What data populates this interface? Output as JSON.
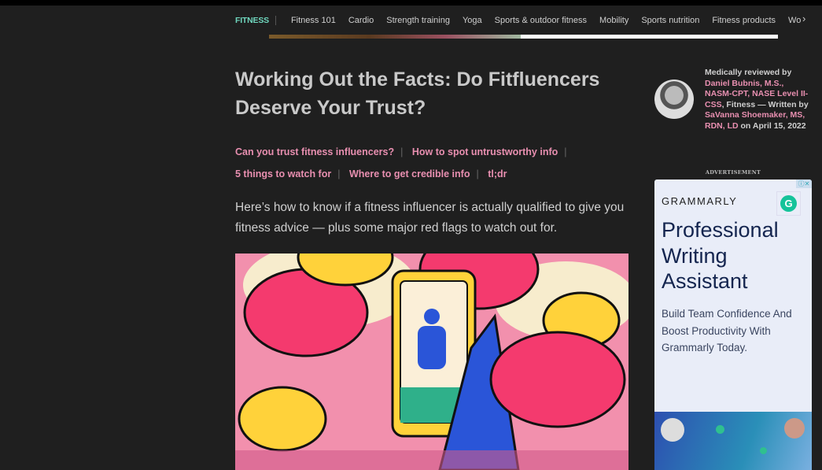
{
  "nav": {
    "brand": "FITNESS",
    "items": [
      "Fitness 101",
      "Cardio",
      "Strength training",
      "Yoga",
      "Sports & outdoor fitness",
      "Mobility",
      "Sports nutrition",
      "Fitness products",
      "Wo"
    ]
  },
  "article": {
    "title": "Working Out the Facts: Do Fitfluencers Deserve Your Trust?",
    "toc": [
      "Can you trust fitness influencers?",
      "How to spot untrustworthy info",
      "5 things to watch for",
      "Where to get credible info",
      "tl;dr"
    ],
    "intro": "Here’s how to know if a fitness influencer is actually qualified to give you fitness advice — plus some major red flags to watch out for."
  },
  "byline": {
    "prefix": "Medically reviewed by",
    "reviewer": "Daniel Bubnis, M.S., NASM-CPT, NASE Level II-CSS",
    "mid": ", Fitness — Written by",
    "author": "SaVanna Shoemaker, MS, RDN, LD",
    "date_prefix": " on ",
    "date": "April 15, 2022"
  },
  "ad": {
    "label": "ADVERTISEMENT",
    "brand": "GRAMMARLY",
    "headline": "Professional Writing Assistant",
    "body": "Build Team Confidence And Boost Productivity With Grammarly Today.",
    "close": "ⓘ✕"
  },
  "colors": {
    "accent": "#e88fb0",
    "brand": "#6fd6bd",
    "background": "#1f1f1f"
  }
}
